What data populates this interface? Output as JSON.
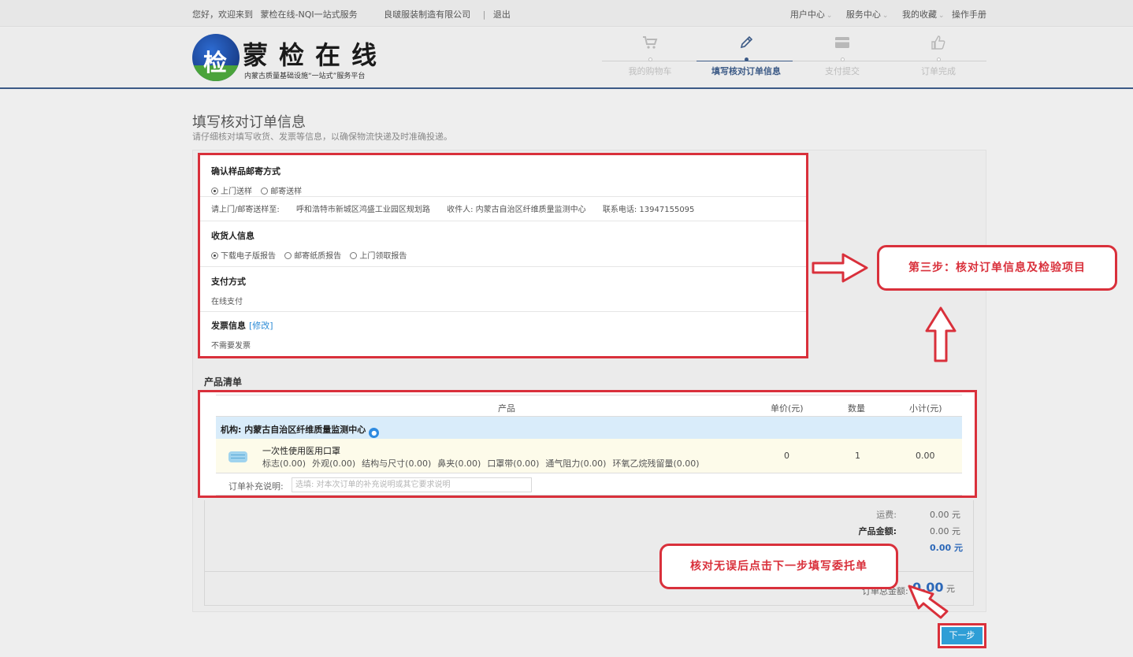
{
  "topbar": {
    "greeting": "您好，欢迎来到",
    "site": "蒙检在线-NQI一站式服务",
    "company": "良啵服装制造有限公司",
    "separator": "|",
    "logout": "退出",
    "menu": [
      "用户中心",
      "服务中心",
      "我的收藏",
      "操作手册"
    ]
  },
  "logo": {
    "badge": "检",
    "title": "蒙检在线",
    "subtitle": "内蒙古质量基础设施“一站式”服务平台"
  },
  "steps": [
    {
      "label": "我的购物车",
      "icon": "cart-icon",
      "active": false
    },
    {
      "label": "填写核对订单信息",
      "icon": "pencil-icon",
      "active": true
    },
    {
      "label": "支付提交",
      "icon": "card-icon",
      "active": false
    },
    {
      "label": "订单完成",
      "icon": "thumbs-up-icon",
      "active": false
    }
  ],
  "page": {
    "title": "填写核对订单信息",
    "subtitle": "请仔细核对填写收货、发票等信息，以确保物流快递及时准确投递。"
  },
  "sample": {
    "title": "确认样品邮寄方式",
    "options": [
      "上门送样",
      "邮寄送样"
    ],
    "selected": 0,
    "address_label": "请上门/邮寄送样至:",
    "address": "呼和浩特市新城区鸿盛工业园区规划路",
    "receiver": "收件人: 内蒙古自治区纤维质量监测中心",
    "phone": "联系电话: 13947155095"
  },
  "receiver": {
    "title": "收货人信息",
    "options": [
      "下载电子版报告",
      "邮寄纸质报告",
      "上门领取报告"
    ],
    "selected": 0
  },
  "payment": {
    "title": "支付方式",
    "value": "在线支付"
  },
  "invoice": {
    "title": "发票信息",
    "edit": "[修改]",
    "value": "不需要发票"
  },
  "products": {
    "section_title": "产品清单",
    "columns": [
      "产品",
      "单价(元)",
      "数量",
      "小计(元)"
    ],
    "org": "机构: 内蒙古自治区纤维质量监测中心",
    "items": [
      {
        "name": "一次性使用医用口罩",
        "attrs": [
          "标志(0.00)",
          "外观(0.00)",
          "结构与尺寸(0.00)",
          "鼻夹(0.00)",
          "口罩带(0.00)",
          "通气阻力(0.00)",
          "环氧乙烷残留量(0.00)"
        ],
        "price": "0",
        "qty": "1",
        "subtotal": "0.00"
      }
    ],
    "note_label": "订单补充说明:",
    "note_placeholder": "选填: 对本次订单的补充说明或其它要求说明"
  },
  "totals": {
    "shipping_label": "运费:",
    "shipping": "0.00 元",
    "product_label": "产品金额:",
    "product": "0.00 元",
    "payable": "0.00 元",
    "order_total_number": "0.00",
    "unit": "元",
    "order_total_label": "订单总金额:"
  },
  "next_button": "下一步",
  "callouts": {
    "step3": "第三步：核对订单信息及检验项目",
    "next_hint": "核对无误后点击下一步填写委托单"
  },
  "colors": {
    "annotation_red": "#d9303b",
    "accent_blue": "#3c5a86",
    "button_blue": "#2e9ed6",
    "org_row_bg": "#d9ecfa"
  }
}
